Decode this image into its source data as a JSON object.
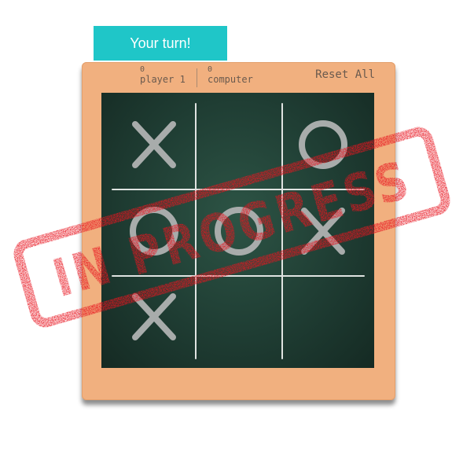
{
  "banner": {
    "text": "Your turn!"
  },
  "scores": {
    "player": {
      "value": "0",
      "label": "player 1"
    },
    "computer": {
      "value": "0",
      "label": "computer"
    }
  },
  "controls": {
    "reset_label": "Reset All"
  },
  "board": {
    "cells": [
      "X",
      "",
      "O",
      "O",
      "O",
      "X",
      "X",
      "",
      ""
    ]
  },
  "stamp": {
    "text": "IN PROGRESS",
    "color": "#e8141f"
  },
  "colors": {
    "banner": "#1fc6c8",
    "frame": "#f1b07f",
    "board": "#1f3d33",
    "marks": "#a8acab",
    "grid": "#dfe3e1"
  }
}
